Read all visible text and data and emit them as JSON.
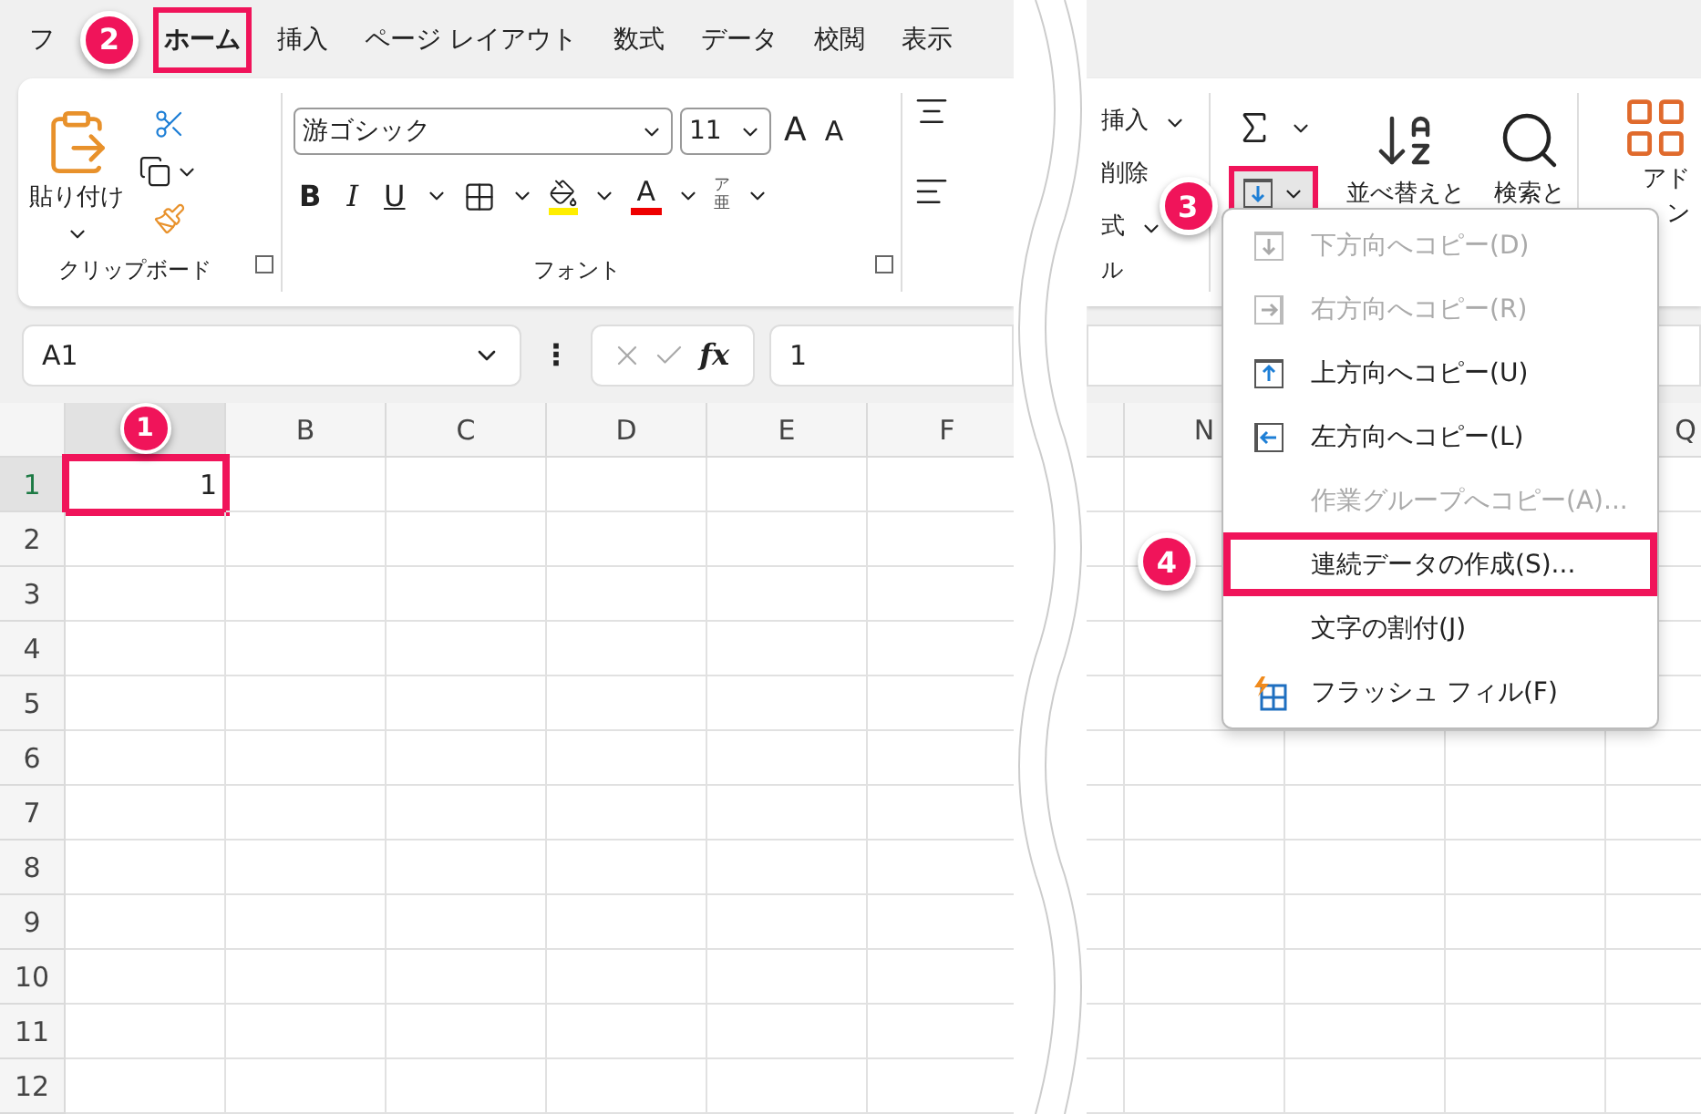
{
  "tabs": [
    {
      "label": "フ",
      "selected": false,
      "highlighted": false
    },
    {
      "label": "ホーム",
      "selected": true,
      "highlighted": true,
      "badge": "2"
    },
    {
      "label": "挿入",
      "selected": false,
      "highlighted": false
    },
    {
      "label": "ページ レイアウト",
      "selected": false,
      "highlighted": false
    },
    {
      "label": "数式",
      "selected": false,
      "highlighted": false
    },
    {
      "label": "データ",
      "selected": false,
      "highlighted": false
    },
    {
      "label": "校閲",
      "selected": false,
      "highlighted": false
    },
    {
      "label": "表示",
      "selected": false,
      "highlighted": false
    }
  ],
  "clipboard": {
    "paste": "貼り付け",
    "group_label": "クリップボード"
  },
  "font": {
    "name": "游ゴシック",
    "size": "11",
    "grow": "A",
    "shrink": "A",
    "bold": "B",
    "italic": "I",
    "underline": "U",
    "font_color": "A",
    "phonetic_top": "ア",
    "phonetic_bottom": "亜",
    "group_label": "フォント"
  },
  "cells_group": {
    "items": [
      "挿入",
      "削除",
      "式"
    ],
    "group_label": "ル"
  },
  "editing": {
    "fill_highlighted": true,
    "fill_badge": "3",
    "sort_label": "並べ替えと",
    "find_label": "検索と"
  },
  "addins": {
    "label_top": "アド",
    "label_bottom": "ン"
  },
  "formula_bar": {
    "name_box": "A1",
    "more": "⋮",
    "fx": "fx",
    "value": "1"
  },
  "grid": {
    "left_columns": [
      {
        "selected": true
      },
      {
        "label": "B",
        "selected": false
      },
      {
        "label": "C",
        "selected": false
      },
      {
        "label": "D",
        "selected": false
      },
      {
        "label": "E",
        "selected": false
      },
      {
        "label": "F",
        "selected": false
      }
    ],
    "right_columns": [
      {
        "label": "N"
      },
      {
        "label": "Q"
      }
    ],
    "rows": [
      {
        "label": "1",
        "selected": true
      },
      {
        "label": "2",
        "selected": false
      },
      {
        "label": "3",
        "selected": false
      },
      {
        "label": "4",
        "selected": false
      },
      {
        "label": "5",
        "selected": false
      },
      {
        "label": "6",
        "selected": false
      },
      {
        "label": "7",
        "selected": false
      },
      {
        "label": "8",
        "selected": false
      },
      {
        "label": "9",
        "selected": false
      },
      {
        "label": "10",
        "selected": false
      },
      {
        "label": "11",
        "selected": false
      },
      {
        "label": "12",
        "selected": false
      }
    ],
    "active_cell": {
      "value": "1",
      "highlighted": true,
      "badge": "1"
    }
  },
  "fill_menu": [
    {
      "label": "下方向へコピー(D)",
      "kind": "down",
      "disabled": true,
      "highlighted": false
    },
    {
      "label": "右方向へコピー(R)",
      "kind": "right",
      "disabled": true,
      "highlighted": false
    },
    {
      "label": "上方向へコピー(U)",
      "kind": "up",
      "disabled": false,
      "highlighted": false
    },
    {
      "label": "左方向へコピー(L)",
      "kind": "left",
      "disabled": false,
      "highlighted": false
    },
    {
      "label": "作業グループへコピー(A)...",
      "kind": "plain",
      "disabled": true,
      "highlighted": false
    },
    {
      "label": "連続データの作成(S)...",
      "kind": "plain",
      "disabled": false,
      "highlighted": true,
      "badge": "4"
    },
    {
      "label": "文字の割付(J)",
      "kind": "plain",
      "disabled": false,
      "highlighted": false
    },
    {
      "label": "フラッシュ フィル(F)",
      "kind": "flash",
      "disabled": false,
      "highlighted": false
    }
  ]
}
